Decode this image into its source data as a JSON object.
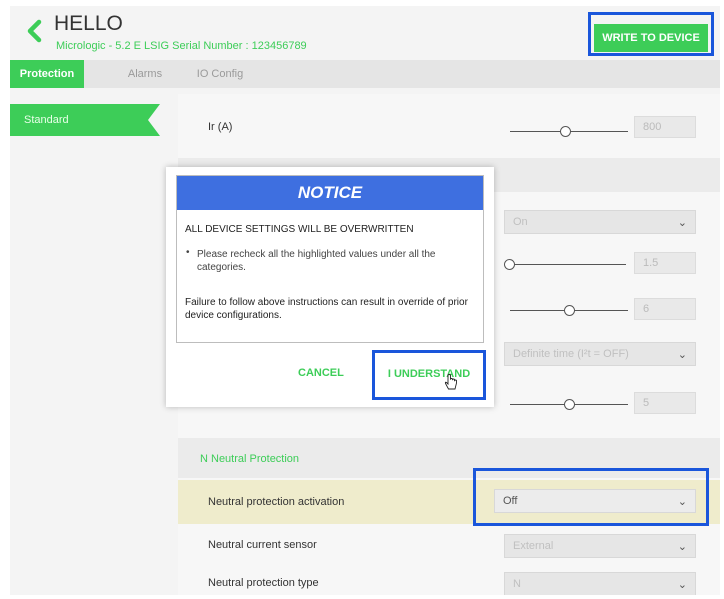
{
  "header": {
    "title": "HELLO",
    "subtitle": "Micrologic - 5.2 E LSIG   Serial Number : 123456789",
    "write_button": "WRITE TO DEVICE"
  },
  "tabs": [
    {
      "label": "Protection",
      "active": true
    },
    {
      "label": "Alarms",
      "active": false
    },
    {
      "label": "IO Config",
      "active": false
    }
  ],
  "sidebar": {
    "items": [
      {
        "label": "Standard",
        "active": true
      }
    ]
  },
  "settings": {
    "ir_label": "Ir (A)",
    "ir_value": "800",
    "sd_select": "On",
    "sd_field_1": "1.5",
    "sd_field_2": "6",
    "tsd_select": "Definite time (I²t = OFF)",
    "tsd_field": "5",
    "neutral_section": "N  Neutral Protection",
    "neutral_activation_label": "Neutral protection activation",
    "neutral_activation_value": "Off",
    "neutral_sensor_label": "Neutral current sensor",
    "neutral_sensor_value": "External",
    "neutral_type_label": "Neutral protection type",
    "neutral_type_value": "N"
  },
  "modal": {
    "title": "NOTICE",
    "heading": "ALL DEVICE SETTINGS WILL BE OVERWRITTEN",
    "bullet": "Please recheck all the highlighted values under all the categories.",
    "footer": "Failure to follow above instructions can result in override of prior device configurations.",
    "cancel": "CANCEL",
    "confirm": "I UNDERSTAND"
  },
  "colors": {
    "accent_green": "#3dcd58",
    "notice_blue": "#3e6fe0",
    "highlight_blue": "#1a56db"
  }
}
